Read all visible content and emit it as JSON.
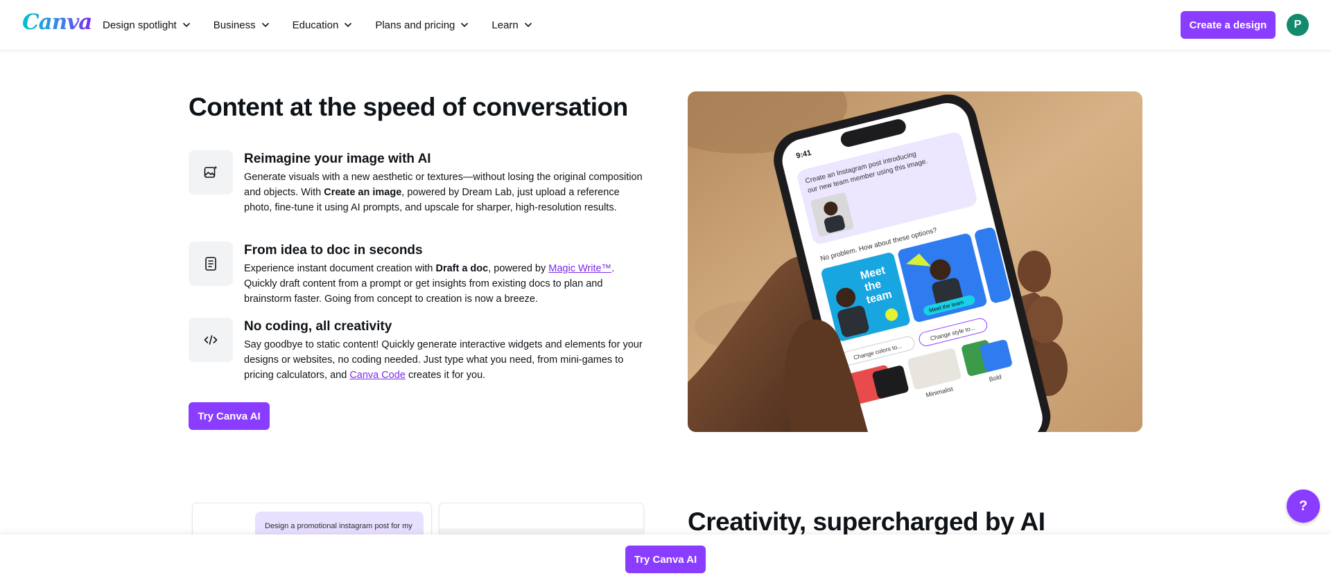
{
  "header": {
    "logo": "Canva",
    "nav": [
      {
        "label": "Design spotlight"
      },
      {
        "label": "Business"
      },
      {
        "label": "Education"
      },
      {
        "label": "Plans and pricing"
      },
      {
        "label": "Learn"
      }
    ],
    "create_button": "Create a design",
    "avatar_initial": "P"
  },
  "section1": {
    "title": "Content at the speed of conversation",
    "features": [
      {
        "icon": "image-sparkle-icon",
        "heading": "Reimagine your image with AI",
        "text_a": "Generate visuals with a new aesthetic or textures—without losing the original composition and objects. With ",
        "bold": "Create an image",
        "text_b": ", powered by Dream Lab, just upload a reference photo, fine-tune it using AI prompts, and upscale for sharper, high-resolution results."
      },
      {
        "icon": "document-icon",
        "heading": "From idea to doc in seconds",
        "text_a": "Experience instant document creation with ",
        "bold": "Draft a doc",
        "text_b": ", powered by ",
        "link": "Magic Write™",
        "text_c": ". Quickly draft content from a prompt or get insights from existing docs to plan and brainstorm faster. Going from concept to creation is now a breeze."
      },
      {
        "icon": "code-icon",
        "heading": "No coding, all creativity",
        "text_a": "Say goodbye to static content! Quickly generate interactive widgets and elements for your designs or websites, no coding needed. Just type what you need, from mini-games to pricing calculators, and ",
        "link": "Canva Code",
        "text_b": " creates it for you."
      }
    ],
    "cta": "Try Canva AI"
  },
  "hero": {
    "time": "9:41",
    "prompt": "Create an Instagram post introducing our new team member using this image.",
    "reply": "No problem. How about these options?",
    "card1": "Meet the team",
    "card2": "Meet the team",
    "chip1": "Change colors to...",
    "chip2": "Change style to...",
    "style_labels": [
      "Minimalist",
      "Bold"
    ]
  },
  "section2": {
    "prompt": "Design a promotional instagram post for my",
    "title": "Creativity, supercharged by AI"
  },
  "sticky": {
    "cta": "Try Canva AI"
  },
  "help": "?"
}
